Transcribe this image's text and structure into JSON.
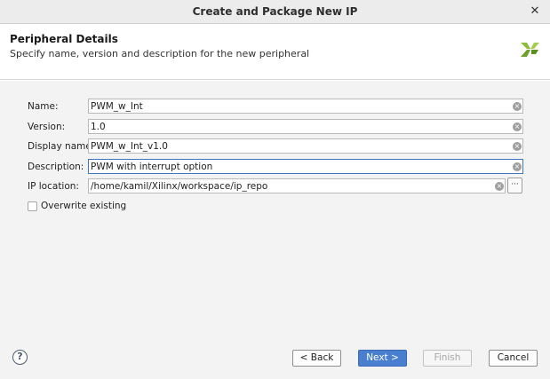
{
  "window": {
    "title": "Create and Package New IP",
    "close_symbol": "✕"
  },
  "header": {
    "title": "Peripheral Details",
    "subtitle": "Specify name, version and description for the new peripheral",
    "logo_icon": "xilinx-logo"
  },
  "form": {
    "name": {
      "label": "Name:",
      "value": "PWM_w_Int"
    },
    "version": {
      "label": "Version:",
      "value": "1.0"
    },
    "display_name": {
      "label": "Display name:",
      "value": "PWM_w_Int_v1.0"
    },
    "description": {
      "label": "Description:",
      "value": "PWM with interrupt option"
    },
    "ip_location": {
      "label": "IP location:",
      "value": "/home/kamil/Xilinx/workspace/ip_repo",
      "browse_label": "···"
    },
    "overwrite": {
      "label": "Overwrite existing",
      "checked": false
    }
  },
  "footer": {
    "help_label": "?",
    "back_label": "< Back",
    "next_label": "Next >",
    "finish_label": "Finish",
    "cancel_label": "Cancel"
  },
  "colors": {
    "accent": "#4a7fd0",
    "focus_border": "#3a78c3",
    "logo_green": "#8dbb3c"
  }
}
